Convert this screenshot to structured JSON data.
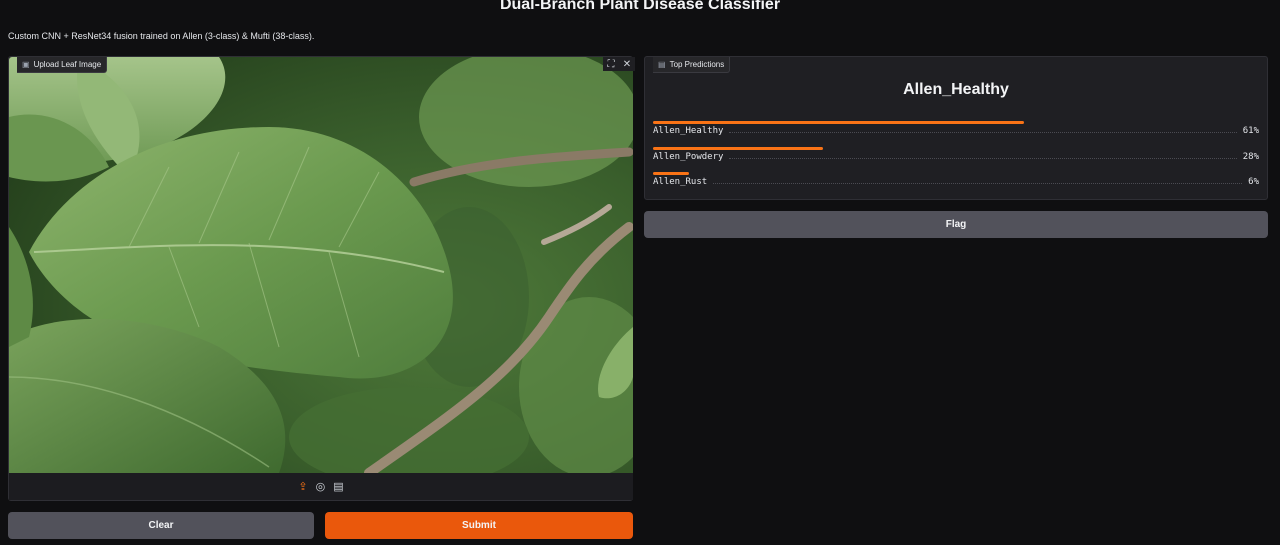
{
  "header": {
    "title": "Dual-Branch Plant Disease Classifier",
    "description": "Custom CNN + ResNet34 fusion trained on Allen (3-class) & Mufti (38-class)."
  },
  "input_panel": {
    "label": "Upload Leaf Image",
    "toolbar_icons": [
      "upload-icon",
      "webcam-icon",
      "clipboard-icon"
    ]
  },
  "output_panel": {
    "label": "Top Predictions",
    "top_label": "Allen_Healthy",
    "predictions": [
      {
        "name": "Allen_Healthy",
        "percent_text": "61%",
        "confidence": 0.61
      },
      {
        "name": "Allen_Powdery",
        "percent_text": "28%",
        "confidence": 0.28
      },
      {
        "name": "Allen_Rust",
        "percent_text": "6%",
        "confidence": 0.06
      }
    ]
  },
  "buttons": {
    "clear": "Clear",
    "submit": "Submit",
    "flag": "Flag"
  },
  "colors": {
    "accent": "#ea580c",
    "background": "#0f0f11",
    "panel": "#1f1f23",
    "button_gray": "#52525b"
  }
}
